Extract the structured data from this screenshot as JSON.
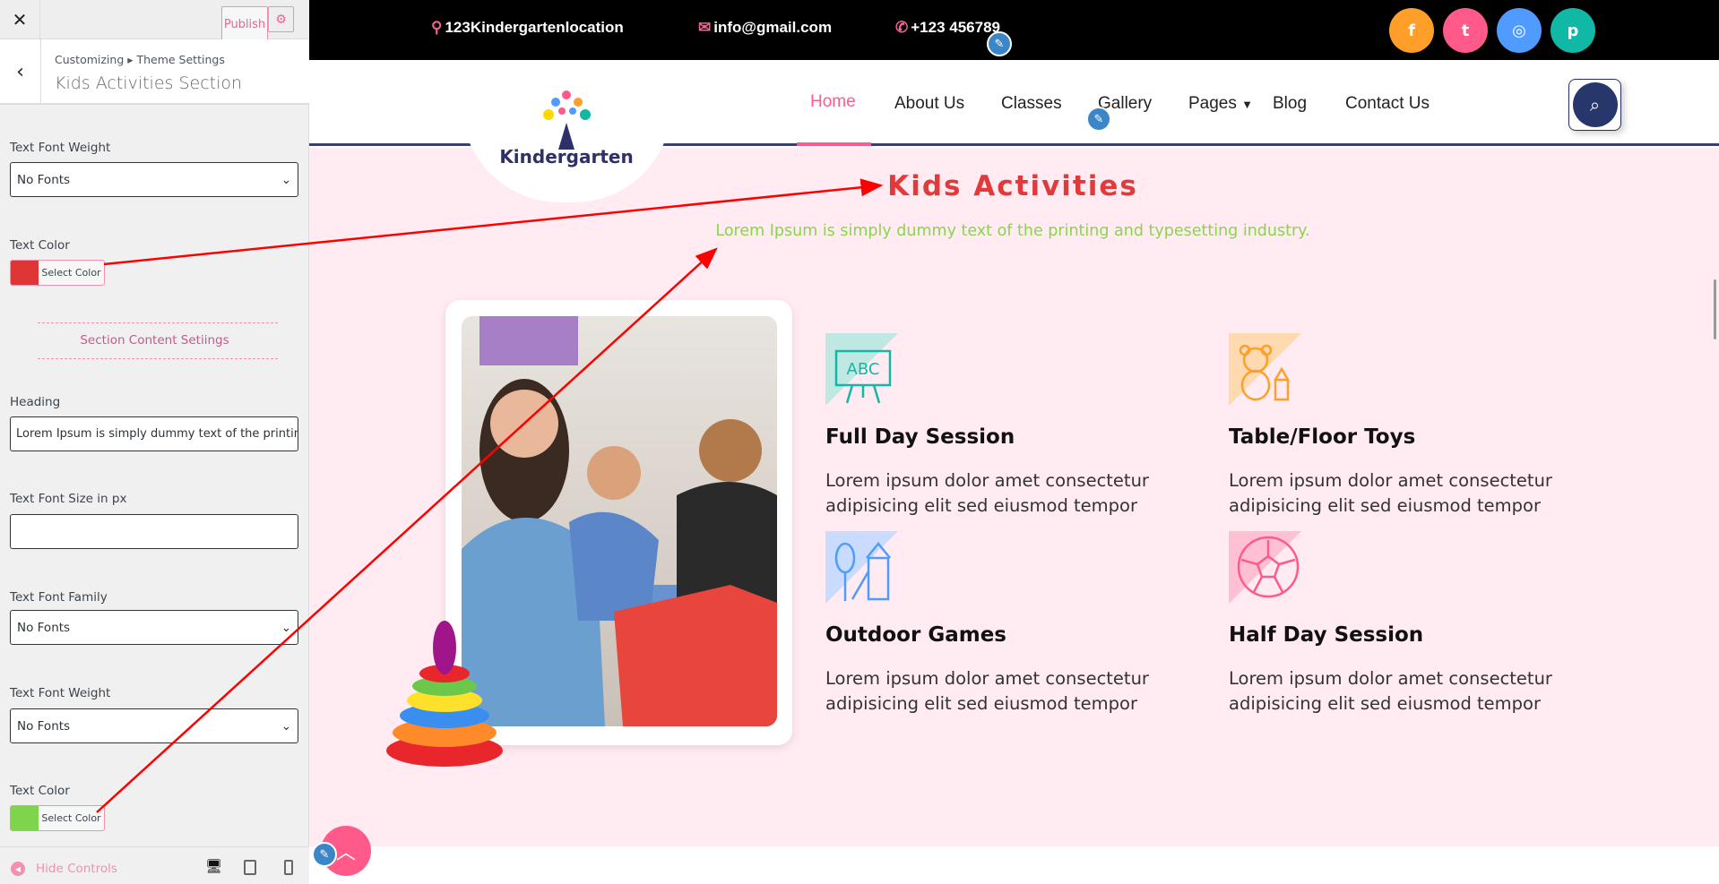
{
  "sidebar": {
    "close": "✕",
    "publish": "Publish",
    "back": "‹",
    "breadcrumb": "Customizing ▸ Theme Settings",
    "title": "Kids Activities Section",
    "fields": [
      {
        "label": "Text Font Weight",
        "value": "No Fonts"
      },
      {
        "label": "Text Color",
        "button": "Select Color",
        "color": "#e03535"
      },
      {
        "section": "Section Content Setiings"
      },
      {
        "label": "Heading",
        "value": "Lorem Ipsum is simply dummy text of the printing"
      },
      {
        "label": "Text Font Size in px",
        "value": ""
      },
      {
        "label": "Text Font Family",
        "value": "No Fonts"
      },
      {
        "label": "Text Font Weight",
        "value": "No Fonts"
      },
      {
        "label": "Text Color",
        "button": "Select Color",
        "color": "#7ed44a"
      }
    ],
    "hide_controls": "Hide Controls"
  },
  "topbar": {
    "location": "123Kindergartenlocation",
    "email": "info@gmail.com",
    "phone": "+123 456789",
    "social": [
      {
        "name": "facebook",
        "color": "#ff9f2a",
        "glyph": "f"
      },
      {
        "name": "twitter",
        "color": "#ff5a8a",
        "glyph": "t"
      },
      {
        "name": "instagram",
        "color": "#4f9bff",
        "glyph": "◎"
      },
      {
        "name": "pinterest",
        "color": "#12b8a6",
        "glyph": "p"
      }
    ]
  },
  "logo": {
    "text": "Kindergarten"
  },
  "nav": [
    "Home",
    "About Us",
    "Classes",
    "Gallery",
    "Pages",
    "Blog",
    "Contact Us"
  ],
  "section": {
    "heading": "Kids Activities",
    "subheading": "Lorem Ipsum is simply dummy text of the printing and typesetting industry.",
    "features": [
      {
        "title": "Full Day Session",
        "desc": "Lorem ipsum dolor amet consectetur adipisicing elit sed eiusmod tempor",
        "icon": "abc-board-icon"
      },
      {
        "title": "Table/Floor Toys",
        "desc": "Lorem ipsum dolor amet consectetur adipisicing elit sed eiusmod tempor",
        "icon": "teddy-bear-icon"
      },
      {
        "title": "Outdoor Games",
        "desc": "Lorem ipsum dolor amet consectetur adipisicing elit sed eiusmod tempor",
        "icon": "playground-icon"
      },
      {
        "title": "Half Day Session",
        "desc": "Lorem ipsum dolor amet consectetur adipisicing elit sed eiusmod tempor",
        "icon": "soccer-ball-icon"
      }
    ]
  }
}
